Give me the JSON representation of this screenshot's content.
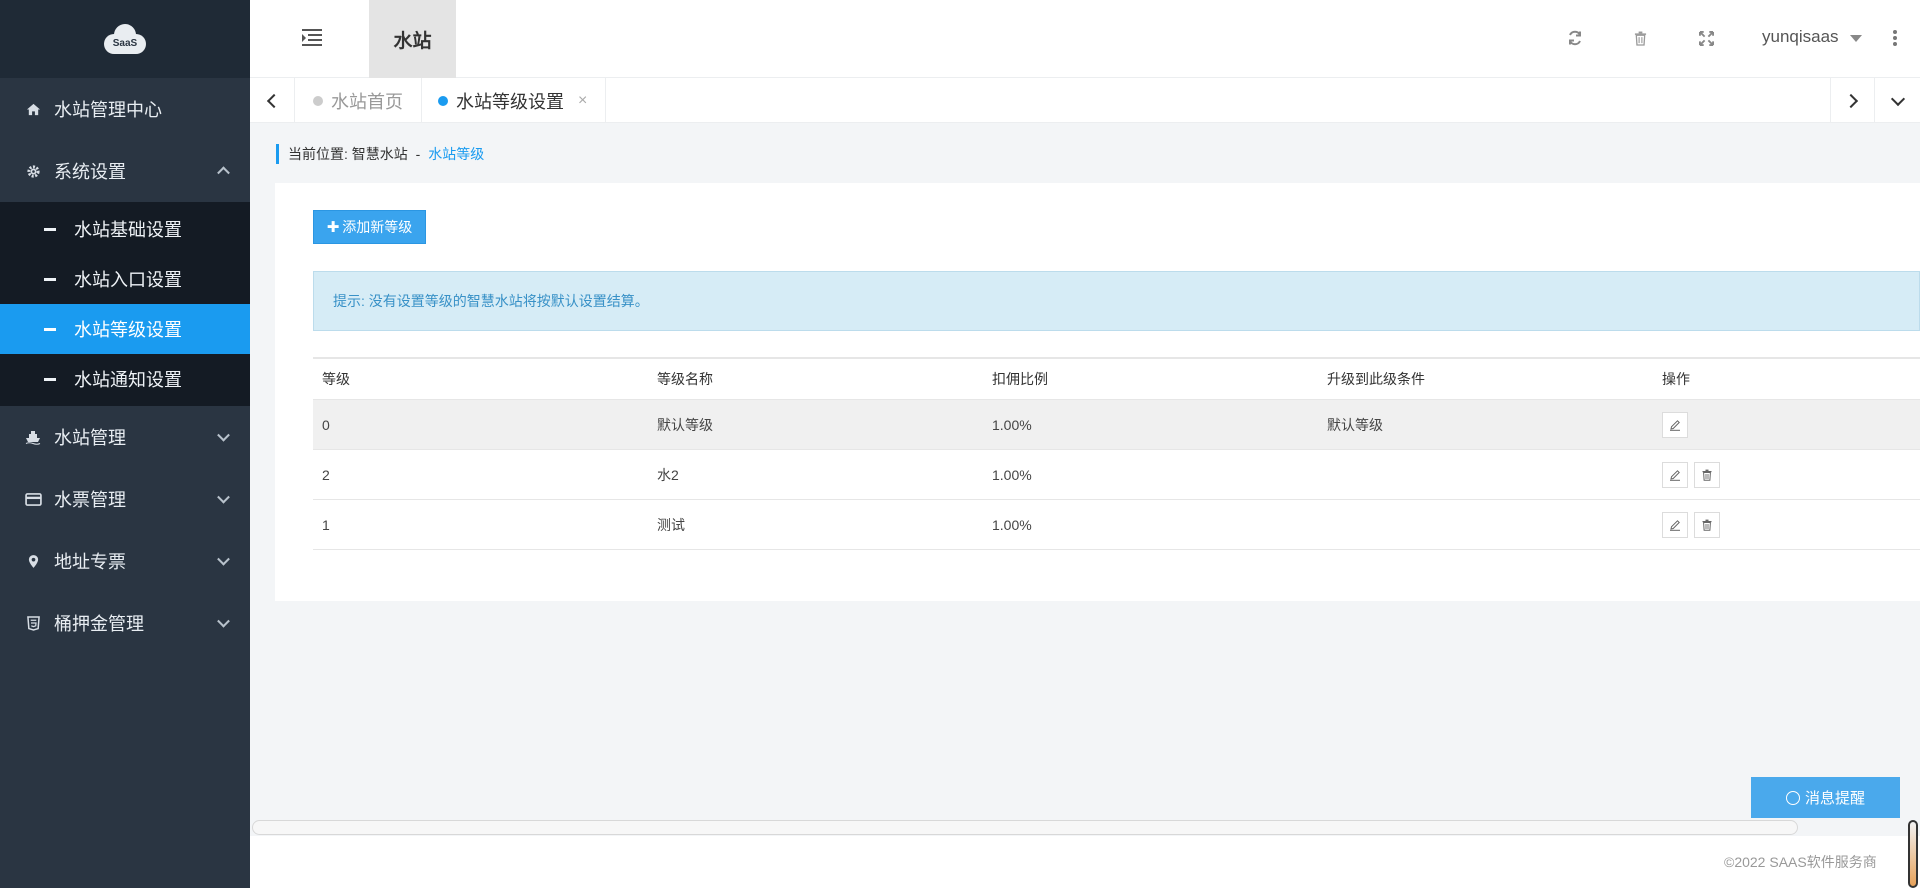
{
  "logo": {
    "text": "SaaS"
  },
  "sidebar": {
    "items": [
      {
        "label": "水站管理中心",
        "icon": "home-icon"
      },
      {
        "label": "系统设置",
        "icon": "gear-icon",
        "expanded": true,
        "children": [
          {
            "label": "水站基础设置"
          },
          {
            "label": "水站入口设置"
          },
          {
            "label": "水站等级设置",
            "active": true
          },
          {
            "label": "水站通知设置"
          }
        ]
      },
      {
        "label": "水站管理",
        "icon": "ship-icon"
      },
      {
        "label": "水票管理",
        "icon": "card-icon"
      },
      {
        "label": "地址专票",
        "icon": "map-pin-icon"
      },
      {
        "label": "桶押金管理",
        "icon": "html5-icon"
      }
    ]
  },
  "header": {
    "tab_label": "水站",
    "user_name": "yunqisaas",
    "icons": [
      "refresh-icon",
      "trash-icon",
      "fullscreen-icon",
      "kebab-icon"
    ]
  },
  "tabs": {
    "items": [
      {
        "label": "水站首页",
        "dot_color": "#cccccc",
        "text_color": "#999999"
      },
      {
        "label": "水站等级设置",
        "dot_color": "#1a9bf0",
        "text_color": "#333333",
        "close": "×"
      }
    ]
  },
  "breadcrumb": {
    "prefix": "当前位置:",
    "parent": "智慧水站",
    "separator": "-",
    "current": "水站等级"
  },
  "content": {
    "add_button": "添加新等级",
    "alert": "提示: 没有设置等级的智慧水站将按默认设置结算。"
  },
  "table": {
    "headers": [
      "等级",
      "等级名称",
      "扣佣比例",
      "升级到此级条件",
      "操作"
    ],
    "rows": [
      {
        "level": "0",
        "name": "默认等级",
        "rate": "1.00%",
        "condition": "默认等级",
        "actions": [
          "edit"
        ]
      },
      {
        "level": "2",
        "name": "水2",
        "rate": "1.00%",
        "condition": "",
        "actions": [
          "edit",
          "delete"
        ]
      },
      {
        "level": "1",
        "name": "测试",
        "rate": "1.00%",
        "condition": "",
        "actions": [
          "edit",
          "delete"
        ]
      }
    ]
  },
  "message_button": "消息提醒",
  "footer": {
    "copyright": "©2022 SAAS软件服务商"
  },
  "colors": {
    "accent": "#1a9bf0",
    "sidebar_bg": "#2a3542",
    "submenu_bg": "#141b24",
    "alert_bg": "#d6ecf6"
  }
}
